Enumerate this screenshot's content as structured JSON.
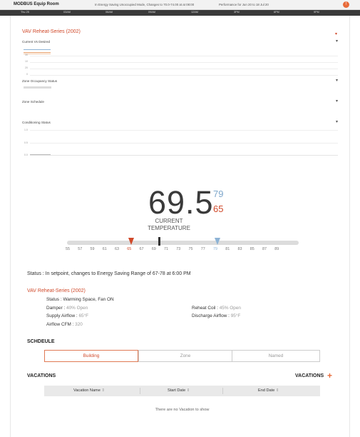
{
  "header": {
    "title": "MODBUS Equip Room",
    "banner": "In Energy Saving Unoccupied Mode, Changes to 70.0-74.00 at at 08:00",
    "performance": "Performance for Jun 20 to 18 Jul 20",
    "alert_icon": "alert-icon"
  },
  "timeline": [
    "Thu 25",
    "03AM",
    "06AM",
    "09AM",
    "12AM",
    "3PM",
    "6PM",
    "9PM"
  ],
  "graphs": {
    "section_title": "VAV Reheat-Series (2002)",
    "current_vs_desired": "Current Vs Desired",
    "cvd_axis": [
      "30",
      "10",
      "20",
      "0"
    ],
    "zone_occupancy": "Zone Occupancy Status",
    "zone_schedule": "Zone Schedule",
    "conditioning": "Conditioning Status",
    "cond_axis": [
      "1.0",
      "0.5",
      "0.0"
    ]
  },
  "thermostat": {
    "current": "69.5",
    "cooling_setpoint": "79",
    "heating_setpoint": "65",
    "current_label": "CURRENT TEMPERATURE",
    "scale": [
      "55",
      "57",
      "59",
      "61",
      "63",
      "65",
      "67",
      "69",
      "71",
      "73",
      "75",
      "77",
      "79",
      "81",
      "83",
      "85",
      "87",
      "89"
    ],
    "heat_value": 65,
    "cool_value": 79,
    "current_value": 69.5,
    "heat_color": "#d0492a",
    "cool_color": "#8db3d5"
  },
  "status": {
    "label": "Status :",
    "text": " In setpoint, changes to Energy Saving Range of 67-78 at 6:00 PM"
  },
  "equipment": {
    "title": "VAV Reheat-Series (2002)",
    "status_label": "Status :",
    "status_value": " Warming Space, Fan ON",
    "damper_label": "Damper :",
    "damper_value": " 40% Open",
    "reheat_label": "Reheat Coil :",
    "reheat_value": " 45% Open",
    "supply_label": "Supply Airflow :",
    "supply_value": " 65°F",
    "discharge_label": "Discharge Airflow :",
    "discharge_value": " 95°F",
    "cfm_label": "Airflow CFM :",
    "cfm_value": " 320"
  },
  "schedule": {
    "title": "SCHDEULE",
    "tabs": [
      "Building",
      "Zone",
      "Named"
    ]
  },
  "vacations": {
    "title": "VACATIONS",
    "add_label": "VACATIONS",
    "add_icon": "plus-icon",
    "columns": [
      "Vacation Name",
      "Start Date",
      "End Date"
    ],
    "empty": "There are no Vacation to show"
  }
}
